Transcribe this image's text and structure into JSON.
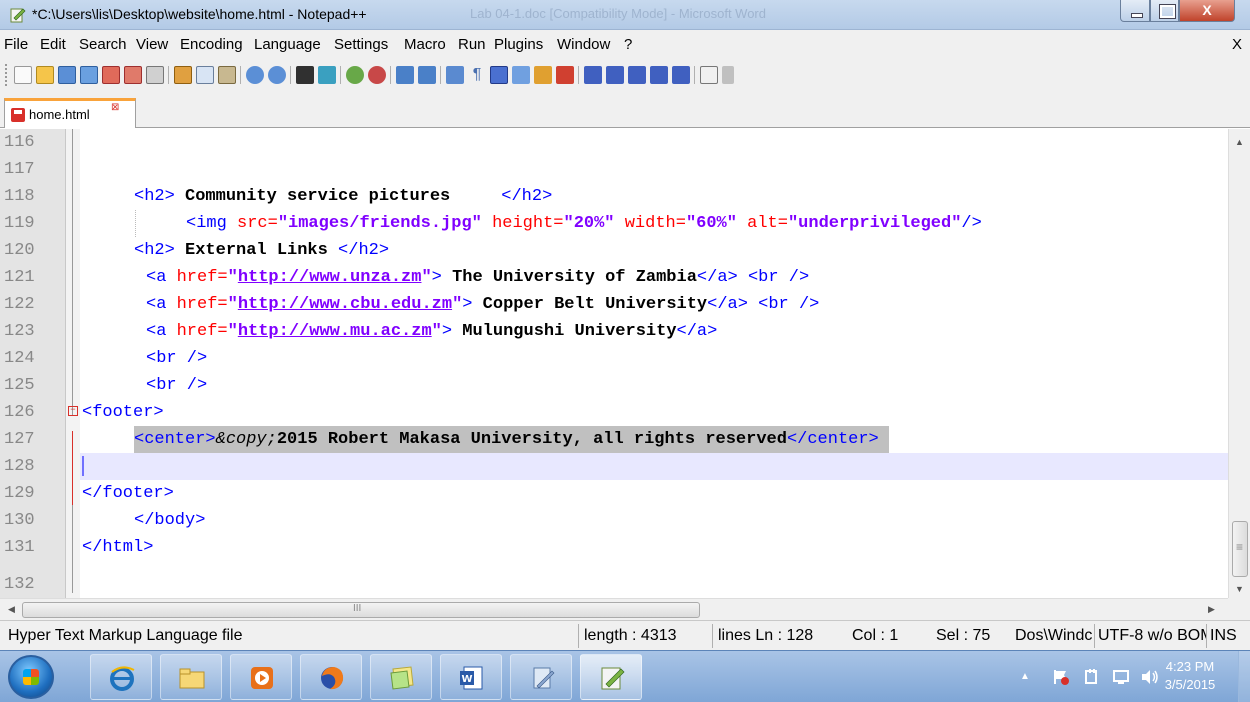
{
  "window": {
    "title": "*C:\\Users\\lis\\Desktop\\website\\home.html - Notepad++",
    "ghost_title": "Lab 04-1.doc [Compatibility Mode] - Microsoft Word",
    "close_glyph": "X"
  },
  "menu": {
    "items": [
      "File",
      "Edit",
      "Search",
      "View",
      "Encoding",
      "Language",
      "Settings",
      "Macro",
      "Run",
      "Plugins",
      "Window",
      "?"
    ],
    "close_label": "X"
  },
  "tab": {
    "label": "home.html",
    "close_glyph": "⊠"
  },
  "editor": {
    "lines": [
      {
        "num": "116"
      },
      {
        "num": "117"
      },
      {
        "num": "118"
      },
      {
        "num": "119"
      },
      {
        "num": "120"
      },
      {
        "num": "121"
      },
      {
        "num": "122"
      },
      {
        "num": "123"
      },
      {
        "num": "124"
      },
      {
        "num": "125"
      },
      {
        "num": "126"
      },
      {
        "num": "127"
      },
      {
        "num": "128"
      },
      {
        "num": "129"
      },
      {
        "num": "130"
      },
      {
        "num": "131"
      },
      {
        "num": "132"
      }
    ],
    "code": {
      "l118_open": "<h2>",
      "l118_text": " Community service pictures     ",
      "l118_close": "</h2>",
      "l119_open": "<img ",
      "l119_src_attr": "src=",
      "l119_src_val": "\"images/friends.jpg\"",
      "l119_h_attr": " height=",
      "l119_h_val": "\"20%\"",
      "l119_w_attr": " width=",
      "l119_w_val": "\"60%\"",
      "l119_alt_attr": " alt=",
      "l119_alt_val": "\"underprivileged\"",
      "l119_end": "/>",
      "l120_open": "<h2>",
      "l120_text": " External Links ",
      "l120_close": "</h2>",
      "a_open": "<a ",
      "href_attr": "href=",
      "quote": "\"",
      "gt": ">",
      "a_close": "</a>",
      "br": "<br />",
      "l121_url": "http://www.unza.zm",
      "l121_text": " The University of Zambia",
      "l122_url": "http://www.cbu.edu.zm",
      "l122_text": " Copper Belt University",
      "l123_url": "http://www.mu.ac.zm",
      "l123_text": " Mulungushi University",
      "footer_open": "<footer>",
      "center_open": "<center>",
      "copy_entity": "&copy;",
      "l127_text": "2015 Robert Makasa University, all rights reserved",
      "center_close": "</center>",
      "footer_close": "</footer>",
      "body_close": "</body>",
      "html_close": "</html>"
    }
  },
  "status": {
    "file_type": "Hyper Text Markup Language file",
    "length": "length : 4313",
    "lines": "lines Ln : 128",
    "col": "Col : 1",
    "sel": "Sel : 75",
    "eol": "Dos\\Windc",
    "encoding": "UTF-8 w/o BOM",
    "mode": "INS"
  },
  "taskbar": {
    "apps": [
      "internet-explorer",
      "file-explorer",
      "media-player",
      "firefox",
      "sticky-notes",
      "word",
      "notepad",
      "notepad-plus-plus"
    ],
    "time": "4:23 PM",
    "date": "3/5/2015"
  },
  "colors": {
    "tag": "#0000ff",
    "attribute": "#ff0000",
    "value": "#8000ff",
    "current_line": "#e8e8ff",
    "selection": "#c0c0c0"
  }
}
